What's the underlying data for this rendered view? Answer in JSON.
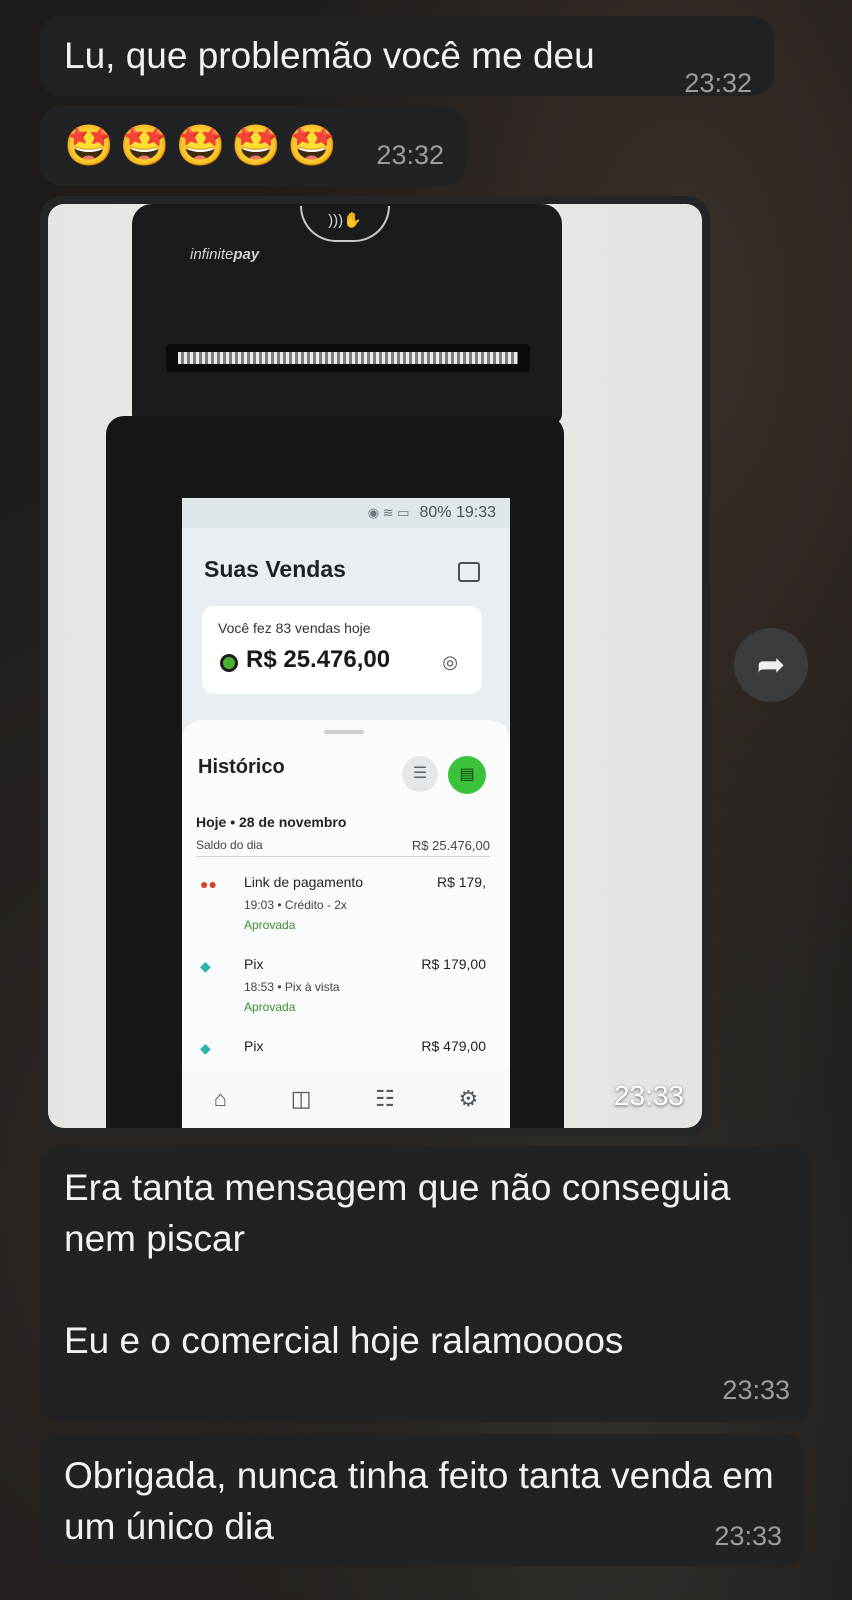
{
  "messages": [
    {
      "text": "Lu, que problemão você me deu",
      "time": "23:32"
    },
    {
      "text": "🤩🤩🤩🤩🤩",
      "time": "23:32"
    },
    {
      "time": "23:33"
    },
    {
      "text": "Era tanta mensagem que não conseguia nem piscar\n\nEu e o comercial hoje ralamoooos",
      "time": "23:33"
    },
    {
      "text": "Obrigada, nunca tinha feito tanta venda em um único dia",
      "time": "23:33"
    }
  ],
  "photo": {
    "device_brand": "infinite",
    "device_brand_bold": "pay",
    "status_bar": "80% 19:33",
    "screen_title": "Suas Vendas",
    "sales_summary": "Você fez 83 vendas hoje",
    "sales_total": "R$ 25.476,00",
    "history_title": "Histórico",
    "day_header": "Hoje • 28 de novembro",
    "saldo_label": "Saldo do dia",
    "saldo_value": "R$ 25.476,00",
    "transactions": [
      {
        "title": "Link de pagamento",
        "detail": "19:03 • Crédito - 2x",
        "status": "Aprovada",
        "value": "R$ 179,"
      },
      {
        "title": "Pix",
        "detail": "18:53 • Pix à vista",
        "status": "Aprovada",
        "value": "R$ 179,00"
      },
      {
        "title": "Pix",
        "value": "R$ 479,00"
      }
    ]
  },
  "icons": {
    "share": "share-arrow",
    "calendar": "calendar",
    "eye": "eye",
    "filter": "sliders",
    "printer": "printer",
    "nav": [
      "store",
      "bag",
      "receipt",
      "gear"
    ]
  },
  "colors": {
    "bubble": "#202223",
    "accent_green": "#3ac23a"
  }
}
